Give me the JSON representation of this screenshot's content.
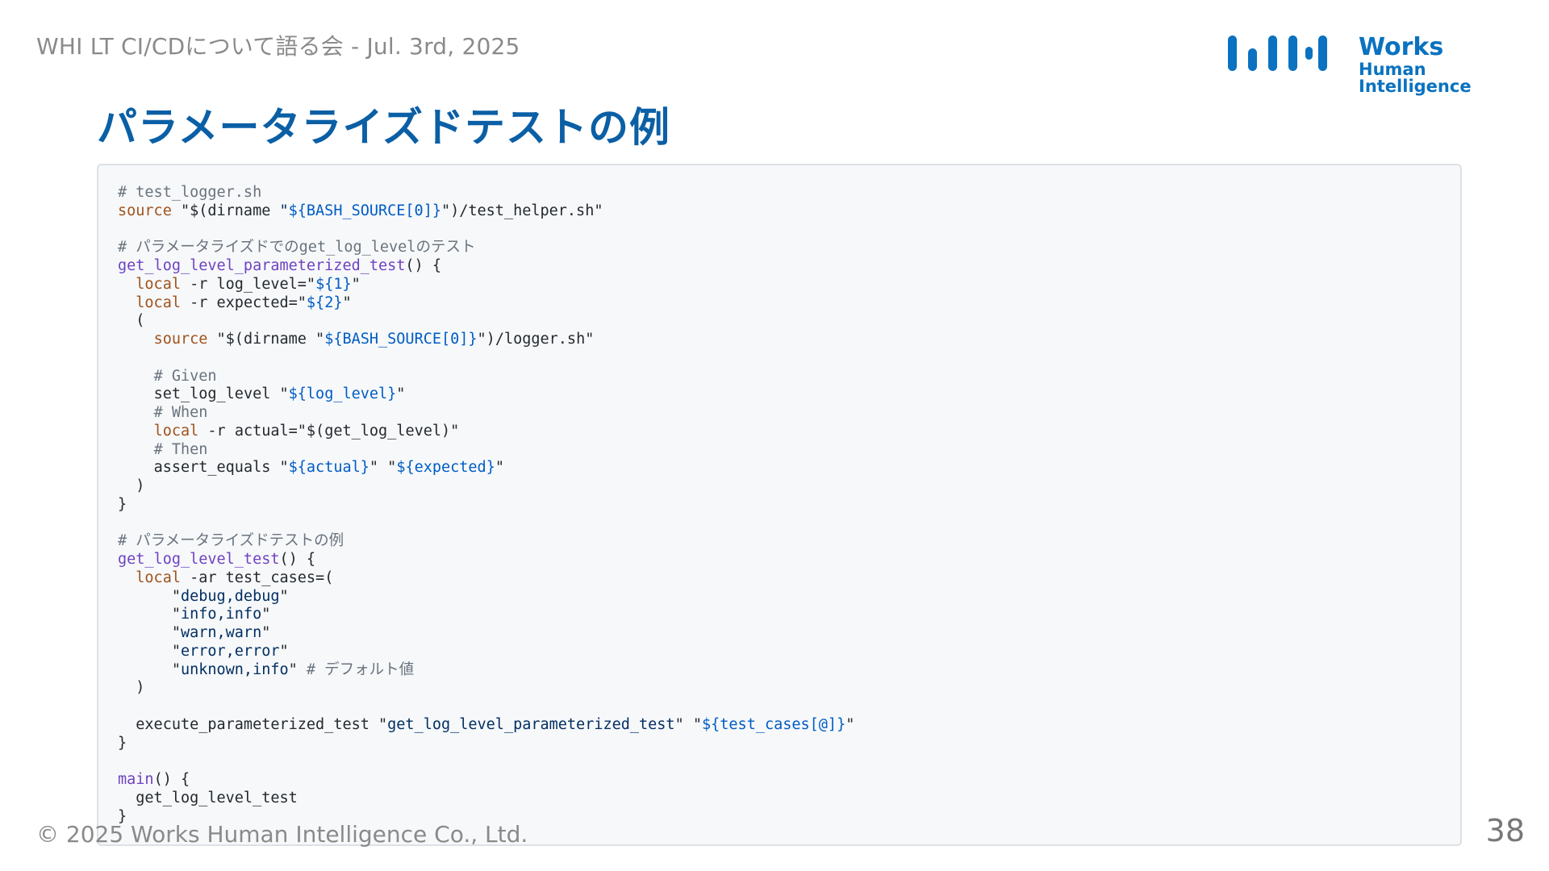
{
  "header": {
    "event_text": "WHI LT CI/CDについて語る会 - Jul. 3rd, 2025"
  },
  "logo": {
    "line1": "Works",
    "line2": "Human Intelligence",
    "color": "#0a72c0"
  },
  "slide": {
    "title": "パラメータライズドテストの例",
    "page_number": "38"
  },
  "footer": {
    "copyright": "© 2025 Works Human Intelligence Co., Ltd."
  },
  "code": {
    "c_file": "# test_logger.sh",
    "kw_source": "source",
    "t_dirname": " \"$(dirname ",
    "q": "\"",
    "v_bash_source": "${BASH_SOURCE[0]}",
    "t_helper_tail": "\")/test_helper.sh\"",
    "c_param_func": "# パラメータライズドでのget_log_levelのテスト",
    "fn_param_test": "get_log_level_parameterized_test",
    "t_paren_brace": "() {",
    "kw_local": "local",
    "t_log_level_assign": " -r log_level=",
    "v_1": "${1}",
    "t_expected_assign": " -r expected=",
    "v_2": "${2}",
    "t_open_paren": "(",
    "t_logger_tail": "\")/logger.sh\"",
    "c_given": "# Given",
    "t_set_log_level": "set_log_level ",
    "v_log_level": "${log_level}",
    "c_when": "# When",
    "t_actual_assign": " -r actual=\"$(get_log_level)\"",
    "c_then": "# Then",
    "t_assert_equals": "assert_equals ",
    "v_actual": "${actual}",
    "v_expected": "${expected}",
    "t_close_paren": ")",
    "t_close_brace": "}",
    "c_example": "# パラメータライズドテストの例",
    "fn_test": "get_log_level_test",
    "t_test_cases": " -ar test_cases=(",
    "s_debug": "debug,debug",
    "s_info": "info,info",
    "s_warn": "warn,warn",
    "s_error": "error,error",
    "s_unknown": "unknown,info",
    "c_default": "# デフォルト値",
    "t_execute": "execute_parameterized_test ",
    "s_func_name": "get_log_level_parameterized_test",
    "v_test_cases": "${test_cases[@]}",
    "fn_main": "main",
    "t_call_test": "get_log_level_test"
  }
}
